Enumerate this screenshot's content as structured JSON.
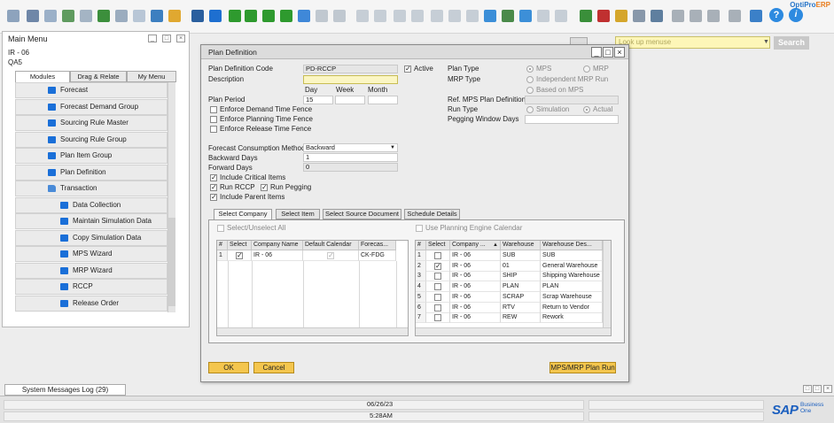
{
  "brand": {
    "part1": "OptiPro",
    "part2": "ERP"
  },
  "search": {
    "placeholder": "Look up menuse",
    "button": "Search"
  },
  "main_menu": {
    "title": "Main Menu",
    "user": "IR - 06",
    "company": "QA5",
    "tabs": [
      "Modules",
      "Drag & Relate",
      "My Menu"
    ],
    "items": [
      {
        "label": "Forecast",
        "indent": 1
      },
      {
        "label": "Forecast Demand Group",
        "indent": 1
      },
      {
        "label": "Sourcing Rule Master",
        "indent": 1
      },
      {
        "label": "Sourcing Rule Group",
        "indent": 1
      },
      {
        "label": "Plan Item Group",
        "indent": 1
      },
      {
        "label": "Plan Definition",
        "indent": 1
      },
      {
        "label": "Transaction",
        "indent": 1,
        "folder": true
      },
      {
        "label": "Data Collection",
        "indent": 2
      },
      {
        "label": "Maintain Simulation Data",
        "indent": 2
      },
      {
        "label": "Copy Simulation Data",
        "indent": 2
      },
      {
        "label": "MPS Wizard",
        "indent": 2
      },
      {
        "label": "MRP Wizard",
        "indent": 2
      },
      {
        "label": "RCCP",
        "indent": 2
      },
      {
        "label": "Release Order",
        "indent": 2
      }
    ]
  },
  "dialog": {
    "title": "Plan Definition",
    "code_label": "Plan Definition Code",
    "code_value": "PD-RCCP",
    "active_label": "Active",
    "description_label": "Description",
    "description_value": "",
    "day_label": "Day",
    "week_label": "Week",
    "month_label": "Month",
    "plan_period_label": "Plan Period",
    "plan_period_day": "15",
    "enforce_demand": "Enforce Demand Time Fence",
    "enforce_planning": "Enforce Planning Time Fence",
    "enforce_release": "Enforce Release Time Fence",
    "fcm_label": "Forecast Consumption Method",
    "fcm_value": "Backward",
    "backward_label": "Backward Days",
    "backward_value": "1",
    "forward_label": "Forward Days",
    "forward_value": "0",
    "include_critical": "Include Critical Items",
    "run_rccp": "Run RCCP",
    "run_pegging": "Run Pegging",
    "include_parent": "Include Parent Items",
    "plan_type_label": "Plan Type",
    "plan_type_mps": "MPS",
    "plan_type_mrp": "MRP",
    "mrp_type_label": "MRP Type",
    "mrp_independent": "Independent MRP Run",
    "mrp_based_mps": "Based on MPS",
    "ref_mps_label": "Ref. MPS Plan Definition",
    "run_type_label": "Run Type",
    "run_simulation": "Simulation",
    "run_actual": "Actual",
    "pegging_window_label": "Pegging Window Days",
    "tabs": [
      "Select Company",
      "Select Item",
      "Select Source Document",
      "Schedule Details"
    ],
    "select_unselect_all": "Select/Unselect All",
    "use_planning_engine": "Use Planning Engine Calendar",
    "company_grid": {
      "headers": [
        "#",
        "Select",
        "Company Name",
        "Default Calendar",
        "Forecas..."
      ],
      "rows": [
        [
          "1",
          "",
          "IR - 06",
          "",
          "CK-FDG"
        ]
      ]
    },
    "warehouse_grid": {
      "headers": [
        "#",
        "Select",
        "Company ...",
        "Warehouse",
        "Warehouse Des..."
      ],
      "rows": [
        [
          "1",
          "",
          "IR - 06",
          "SUB",
          "SUB"
        ],
        [
          "2",
          "",
          "IR - 06",
          "01",
          "General Warehouse"
        ],
        [
          "3",
          "",
          "IR - 06",
          "SHIP",
          "Shipping Warehouse"
        ],
        [
          "4",
          "",
          "IR - 06",
          "PLAN",
          "PLAN"
        ],
        [
          "5",
          "",
          "IR - 06",
          "SCRAP",
          "Scrap Warehouse"
        ],
        [
          "6",
          "",
          "IR - 06",
          "RTV",
          "Return to Vendor"
        ],
        [
          "7",
          "",
          "IR - 06",
          "REW",
          "Rework"
        ]
      ]
    },
    "ok_label": "OK",
    "cancel_label": "Cancel",
    "plan_run_label": "MPS/MRP Plan Run"
  },
  "system_messages": "System Messages Log (29)",
  "status": {
    "date": "06/26/23",
    "time": "5:28AM"
  },
  "sap": {
    "logo": "SAP",
    "line1": "Business",
    "line2": "One"
  }
}
